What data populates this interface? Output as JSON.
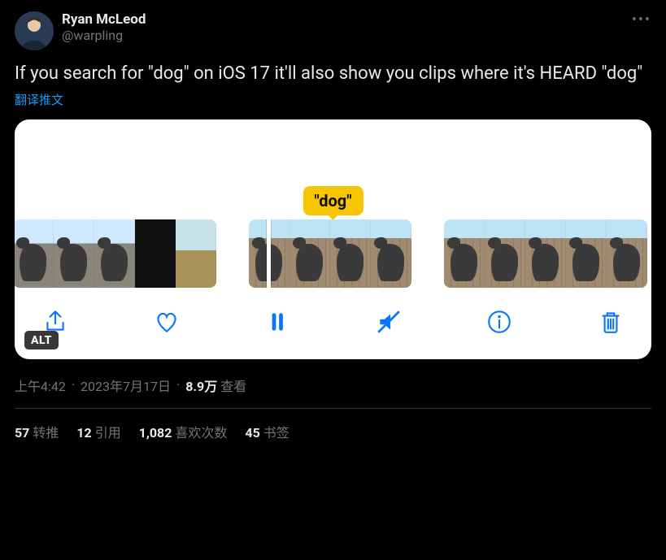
{
  "author": {
    "display_name": "Ryan McLeod",
    "handle": "@warpling"
  },
  "tweet_text": "If you search for \"dog\" on iOS 17 it'll also show you clips where it's HEARD \"dog\"",
  "translate_label": "翻译推文",
  "media": {
    "caption_text": "\"dog\"",
    "alt_badge": "ALT"
  },
  "meta": {
    "time": "上午4:42",
    "date": "2023年7月17日",
    "views_count": "8.9万",
    "views_label": "查看"
  },
  "stats": {
    "retweets_count": "57",
    "retweets_label": "转推",
    "quotes_count": "12",
    "quotes_label": "引用",
    "likes_count": "1,082",
    "likes_label": "喜欢次数",
    "bookmarks_count": "45",
    "bookmarks_label": "书签"
  }
}
